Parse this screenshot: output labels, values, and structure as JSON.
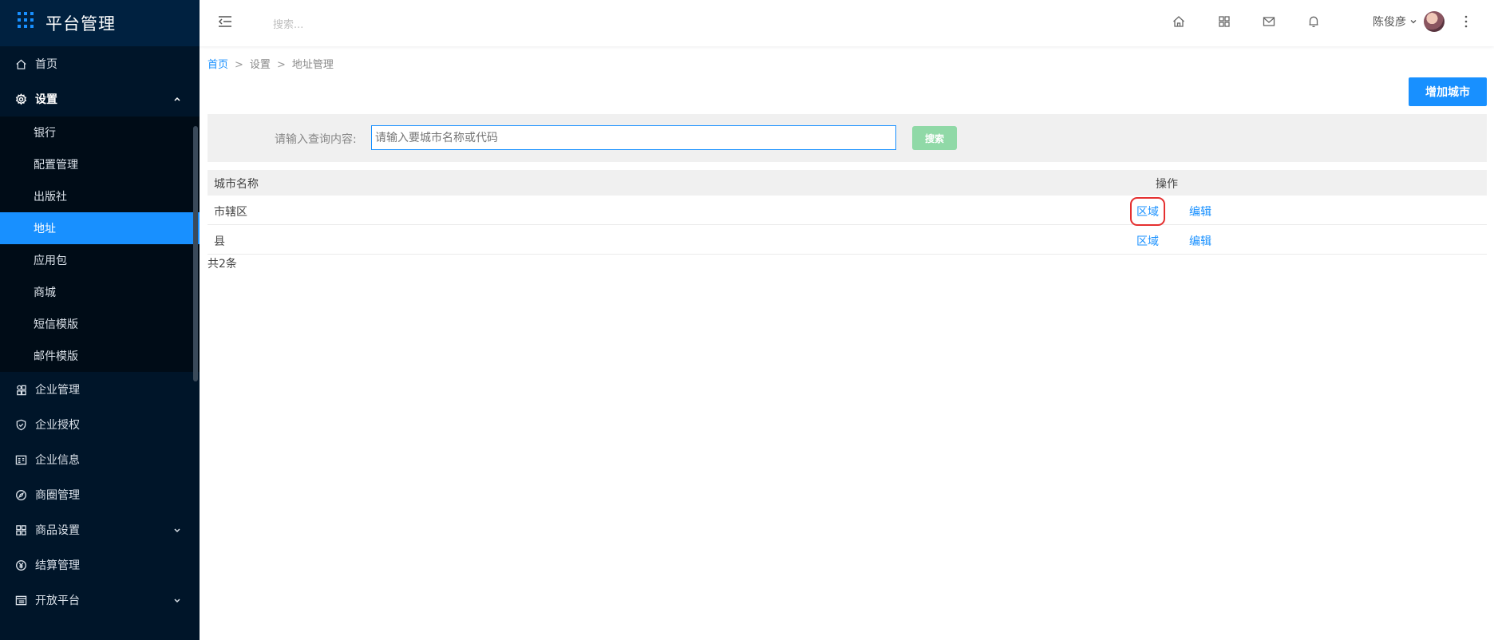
{
  "brand": {
    "title": "平台管理"
  },
  "sidebar": {
    "items": [
      {
        "label": "首页",
        "icon": "home-icon"
      },
      {
        "label": "设置",
        "icon": "gear-icon",
        "open": true,
        "children": [
          "银行",
          "配置管理",
          "出版社",
          "地址",
          "应用包",
          "商城",
          "短信模版",
          "邮件模版"
        ],
        "active_child": "地址"
      },
      {
        "label": "企业管理",
        "icon": "enterprise-icon"
      },
      {
        "label": "企业授权",
        "icon": "shield-icon"
      },
      {
        "label": "企业信息",
        "icon": "id-card-icon"
      },
      {
        "label": "商圈管理",
        "icon": "compass-icon"
      },
      {
        "label": "商品设置",
        "icon": "apps-icon",
        "expandable": true
      },
      {
        "label": "结算管理",
        "icon": "yen-icon"
      },
      {
        "label": "开放平台",
        "icon": "platform-icon",
        "expandable": true
      }
    ]
  },
  "header": {
    "search_placeholder": "搜索...",
    "user_name": "陈俊彦"
  },
  "breadcrumb": {
    "home": "首页",
    "level2": "设置",
    "current": "地址管理",
    "sep": ">"
  },
  "toolbar": {
    "add_label": "增加城市"
  },
  "filter": {
    "label": "请输入查询内容:",
    "placeholder": "请输入要城市名称或代码",
    "search_label": "搜索"
  },
  "table": {
    "columns": [
      "城市名称",
      "操作"
    ],
    "rows": [
      {
        "name": "市辖区",
        "action1": "区域",
        "action2": "编辑"
      },
      {
        "name": "县",
        "action1": "区域",
        "action2": "编辑"
      }
    ],
    "total": "共2条"
  },
  "colors": {
    "primary": "#1890ff",
    "sidebar_bg": "#001529",
    "search_btn": "#90d9a7",
    "highlight": "#e53030"
  }
}
